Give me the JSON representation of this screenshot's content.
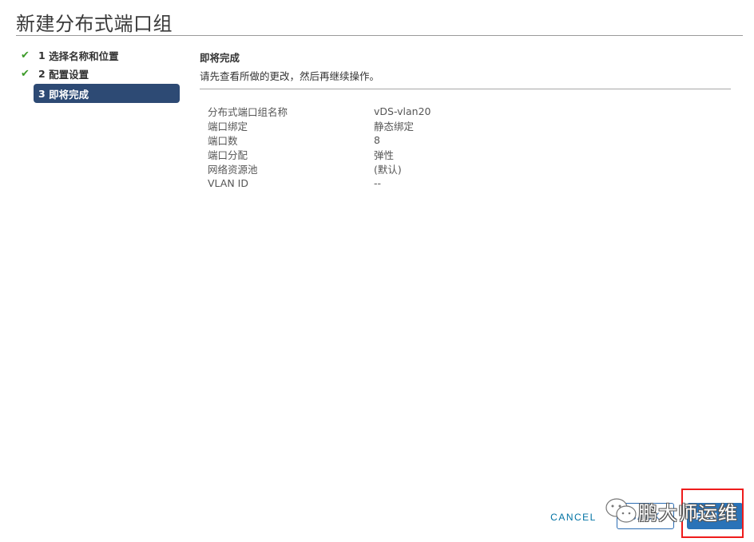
{
  "window": {
    "title": "新建分布式端口组"
  },
  "steps": [
    {
      "number": "1",
      "label": "选择名称和位置",
      "status": "completed"
    },
    {
      "number": "2",
      "label": "配置设置",
      "status": "completed"
    },
    {
      "number": "3",
      "label": "即将完成",
      "status": "active"
    }
  ],
  "content": {
    "title": "即将完成",
    "description": "请先查看所做的更改，然后再继续操作。",
    "summary": [
      {
        "key": "分布式端口组名称",
        "value": "vDS-vlan20"
      },
      {
        "key": "端口绑定",
        "value": "静态绑定"
      },
      {
        "key": "端口数",
        "value": "8"
      },
      {
        "key": "端口分配",
        "value": "弹性"
      },
      {
        "key": "网络资源池",
        "value": "(默认)"
      },
      {
        "key": "VLAN ID",
        "value": "--"
      }
    ]
  },
  "footer": {
    "cancel_label": "CANCEL",
    "back_label": "BACK",
    "finish_label": "FINISH"
  },
  "watermark": {
    "icon": "wechat-icon",
    "text": "鹏大师运维"
  },
  "colors": {
    "active_step": "#2d4a74",
    "check": "#3d9b29",
    "primary": "#2a73b8",
    "highlight": "#ee1c1c"
  }
}
